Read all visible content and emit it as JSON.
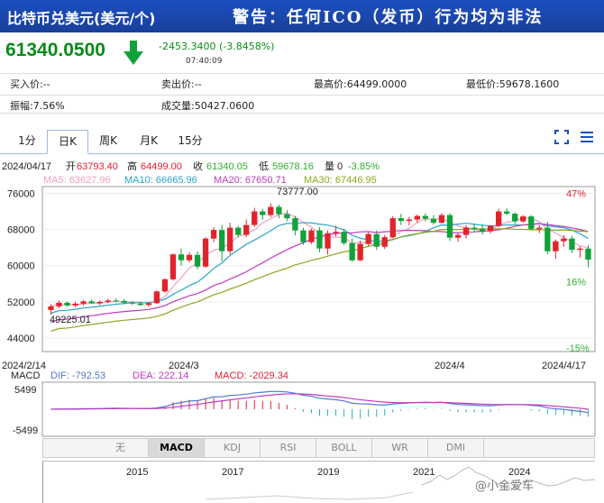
{
  "header": {
    "title": "比特币兑美元(美元/个)",
    "warning": "警告：任何ICO（发币）行为均为非法"
  },
  "quote": {
    "price": "61340.0500",
    "change": "-2453.3400 (-3.8458%)",
    "time": "07:40:09",
    "buy": "买入价:--",
    "sell": "卖出价:--",
    "high": "最高价:64499.0000",
    "low": "最低价:59678.1600",
    "amplitude": "振幅:7.56%",
    "volume": "成交量:50427.0600"
  },
  "tabs": [
    "1分",
    "日K",
    "周K",
    "月K",
    "15分"
  ],
  "active_tab": "日K",
  "icons": [
    "fullscreen-icon",
    "menu-icon",
    "arrow-down-icon"
  ],
  "colors": {
    "up": "#e0242b",
    "down": "#11a23a",
    "header": "#1c4fbf"
  },
  "ohlc_line": {
    "date": "2024/04/17",
    "open_label": "开",
    "open": "63793.40",
    "high_label": "高",
    "high": "64499.00",
    "close_label": "收",
    "close": "61340.05",
    "low_label": "低",
    "low": "59678.16",
    "vol_label": "量",
    "vol": "0",
    "pct": "-3.85%"
  },
  "ma_legend": {
    "ma5": "MA5: 63627.96",
    "ma10": "MA10: 66665.96",
    "ma20": "MA20: 67650.71",
    "ma30": "MA30: 67446.95"
  },
  "macd_legend": {
    "name": "MACD",
    "dif": "DIF: -792.53",
    "dea": "DEA: 222.14",
    "macd": "MACD: -2029.34"
  },
  "indicators": [
    "无",
    "MACD",
    "KDJ",
    "RSI",
    "BOLL",
    "WR",
    "DMI"
  ],
  "active_indicator": "MACD",
  "nav": {
    "left": "▲",
    "right": "◀"
  },
  "overview_years": [
    "2015",
    "2017",
    "2019",
    "2021",
    "2024"
  ],
  "watermark": "@小金爱车",
  "chart_data": {
    "type": "candlestick",
    "y_ticks": [
      "76000",
      "68000",
      "60000",
      "52000",
      "44000"
    ],
    "pct_ticks": [
      "47%",
      "16%",
      "-15%"
    ],
    "x_ticks": [
      "2024/2/14",
      "2024/3",
      "2024/4",
      "2024/4/17"
    ],
    "ylim": [
      41000,
      77500
    ],
    "max_label": "73777.00",
    "min_label": "49225.01",
    "macd_ticks": [
      "5499",
      "-5499"
    ],
    "candles": [
      [
        50200,
        51500,
        49225,
        51000
      ],
      [
        51000,
        52300,
        50600,
        51800
      ],
      [
        51800,
        52100,
        50900,
        51200
      ],
      [
        51200,
        52000,
        50800,
        51600
      ],
      [
        51600,
        52400,
        51200,
        52100
      ],
      [
        52100,
        52500,
        51500,
        51700
      ],
      [
        51700,
        52300,
        51300,
        52000
      ],
      [
        52000,
        52700,
        51700,
        52300
      ],
      [
        52300,
        52800,
        51900,
        52200
      ],
      [
        52200,
        52600,
        51500,
        51800
      ],
      [
        51800,
        52200,
        51300,
        51600
      ],
      [
        51600,
        52100,
        51100,
        51300
      ],
      [
        51300,
        52000,
        50900,
        51700
      ],
      [
        51700,
        54500,
        51500,
        54300
      ],
      [
        54300,
        57200,
        54000,
        57000
      ],
      [
        57000,
        62700,
        56700,
        62500
      ],
      [
        62500,
        63800,
        60000,
        61200
      ],
      [
        61200,
        63000,
        60700,
        62400
      ],
      [
        62400,
        63200,
        59200,
        59800
      ],
      [
        59800,
        66300,
        59500,
        66000
      ],
      [
        66000,
        68500,
        65200,
        67900
      ],
      [
        67900,
        69000,
        61000,
        63200
      ],
      [
        63200,
        69500,
        62500,
        68400
      ],
      [
        68400,
        68800,
        66200,
        66800
      ],
      [
        66800,
        70200,
        66300,
        69000
      ],
      [
        69000,
        72800,
        68500,
        72000
      ],
      [
        72000,
        72600,
        70200,
        71200
      ],
      [
        71200,
        73777,
        70700,
        73000
      ],
      [
        73000,
        73500,
        70500,
        71400
      ],
      [
        71400,
        72300,
        69800,
        70500
      ],
      [
        70500,
        71000,
        66700,
        67800
      ],
      [
        67800,
        68400,
        64600,
        65200
      ],
      [
        65200,
        68200,
        64800,
        67800
      ],
      [
        67800,
        68500,
        63000,
        63800
      ],
      [
        63800,
        67800,
        62500,
        67200
      ],
      [
        67200,
        68800,
        66500,
        67500
      ],
      [
        67500,
        68200,
        64500,
        65000
      ],
      [
        65000,
        66000,
        60900,
        61200
      ],
      [
        61200,
        65500,
        61000,
        64800
      ],
      [
        64800,
        67400,
        64300,
        67000
      ],
      [
        67000,
        67800,
        63500,
        64200
      ],
      [
        64200,
        66800,
        63700,
        66300
      ],
      [
        66300,
        71000,
        66000,
        70500
      ],
      [
        70500,
        71500,
        69000,
        69900
      ],
      [
        69900,
        70800,
        68900,
        70200
      ],
      [
        70200,
        71300,
        69500,
        71000
      ],
      [
        71000,
        71600,
        69800,
        70400
      ],
      [
        70400,
        71200,
        69100,
        69500
      ],
      [
        69500,
        71600,
        69300,
        71200
      ],
      [
        71200,
        71600,
        65500,
        66200
      ],
      [
        66200,
        67200,
        65300,
        66800
      ],
      [
        66800,
        69000,
        66000,
        68400
      ],
      [
        68400,
        69300,
        67500,
        68100
      ],
      [
        68100,
        69200,
        66900,
        67600
      ],
      [
        67600,
        69000,
        67100,
        68800
      ],
      [
        68800,
        72600,
        68500,
        72000
      ],
      [
        72000,
        72700,
        71200,
        71500
      ],
      [
        71500,
        71800,
        69200,
        69800
      ],
      [
        69800,
        71200,
        69500,
        70900
      ],
      [
        70900,
        71200,
        67800,
        68100
      ],
      [
        68100,
        69000,
        67200,
        68400
      ],
      [
        68400,
        69700,
        62500,
        63200
      ],
      [
        63200,
        65800,
        61500,
        65400
      ],
      [
        65400,
        66800,
        64200,
        66000
      ],
      [
        66000,
        66600,
        62800,
        63500
      ],
      [
        63500,
        64300,
        61800,
        63793
      ],
      [
        63793,
        64499,
        59678,
        61340
      ]
    ]
  }
}
